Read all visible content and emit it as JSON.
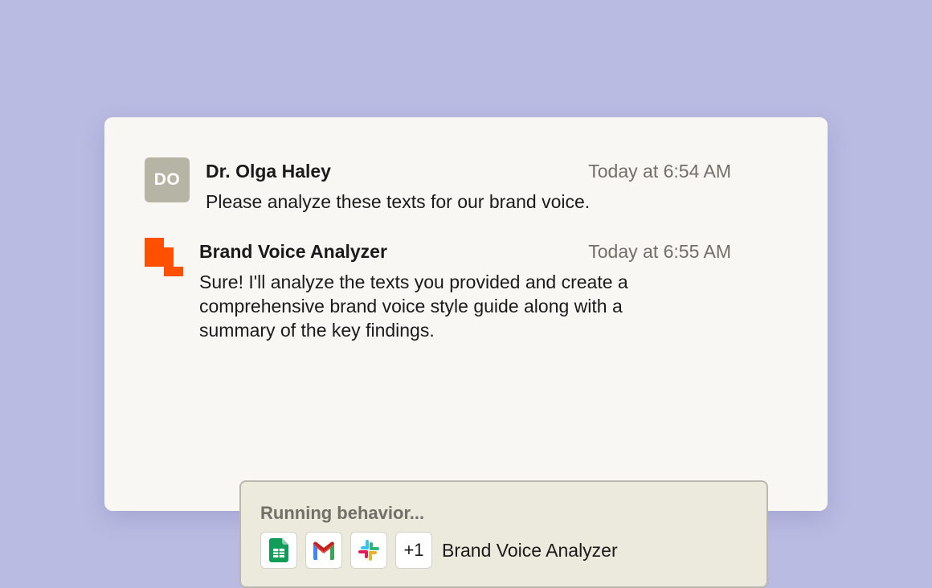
{
  "messages": [
    {
      "sender": "Dr. Olga Haley",
      "initials": "DO",
      "timestamp": "Today at 6:54 AM",
      "text": "Please analyze these texts for our brand voice."
    },
    {
      "sender": "Brand Voice Analyzer",
      "timestamp": "Today at 6:55 AM",
      "text": "Sure! I'll analyze the texts you provided and create a comprehensive brand voice style guide along with a summary of the key findings."
    }
  ],
  "behavior": {
    "status": "Running behavior...",
    "more_apps": "+1",
    "name": "Brand Voice Analyzer",
    "apps": [
      "google-sheets-icon",
      "gmail-icon",
      "slack-icon"
    ]
  },
  "colors": {
    "background": "#b9bbe3",
    "card": "#f8f7f4",
    "brand_logo": "#ff4f00",
    "avatar": "#b6b4a5",
    "behavior_box": "#ece9dd"
  }
}
